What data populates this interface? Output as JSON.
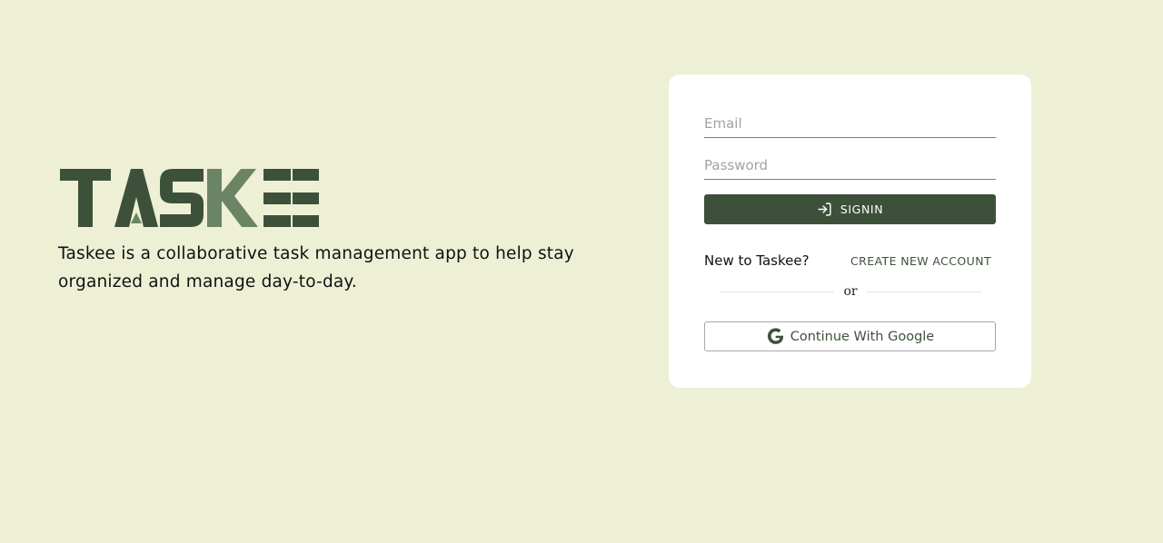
{
  "brand": {
    "name": "TASKEE",
    "tagline": "Taskee is a collaborative task management app to help stay organized and manage day-to-day.",
    "colors": {
      "dark_green": "#3d513a",
      "light_green": "#6b8464",
      "background": "#edf0d5"
    }
  },
  "login": {
    "email_placeholder": "Email",
    "password_placeholder": "Password",
    "signin_label": "SIGNIN",
    "signin_icon": "login-icon",
    "new_prompt": "New to Taskee?",
    "create_label": "CREATE NEW ACCOUNT",
    "or_label": "or",
    "google_label": "Continue With Google",
    "google_icon": "google-icon"
  }
}
